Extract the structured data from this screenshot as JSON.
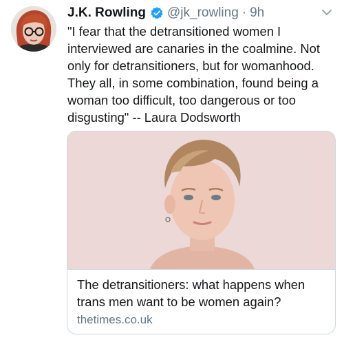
{
  "tweet": {
    "display_name": "J.K. Rowling",
    "handle": "@jk_rowling",
    "separator": "·",
    "time": "9h",
    "text": "\"I fear that the detransitioned women I\ninterviewed are canaries in the coalmine. Not\nonly for detransitioners, but for womanhood.\nThey all, in some combination, found being a\nwoman too difficult, too dangerous or too\ndisgusting\" -- Laura Dodsworth"
  },
  "card": {
    "title": "The detransitioners: what happens when\ntrans men want to be women again?",
    "domain": "thetimes.co.uk"
  },
  "icons": {
    "verified": "verified-badge-icon",
    "caret": "chevron-down-icon"
  },
  "colors": {
    "verified_blue": "#1da1f2",
    "secondary_text": "#657786",
    "border": "#ccd6dd"
  }
}
